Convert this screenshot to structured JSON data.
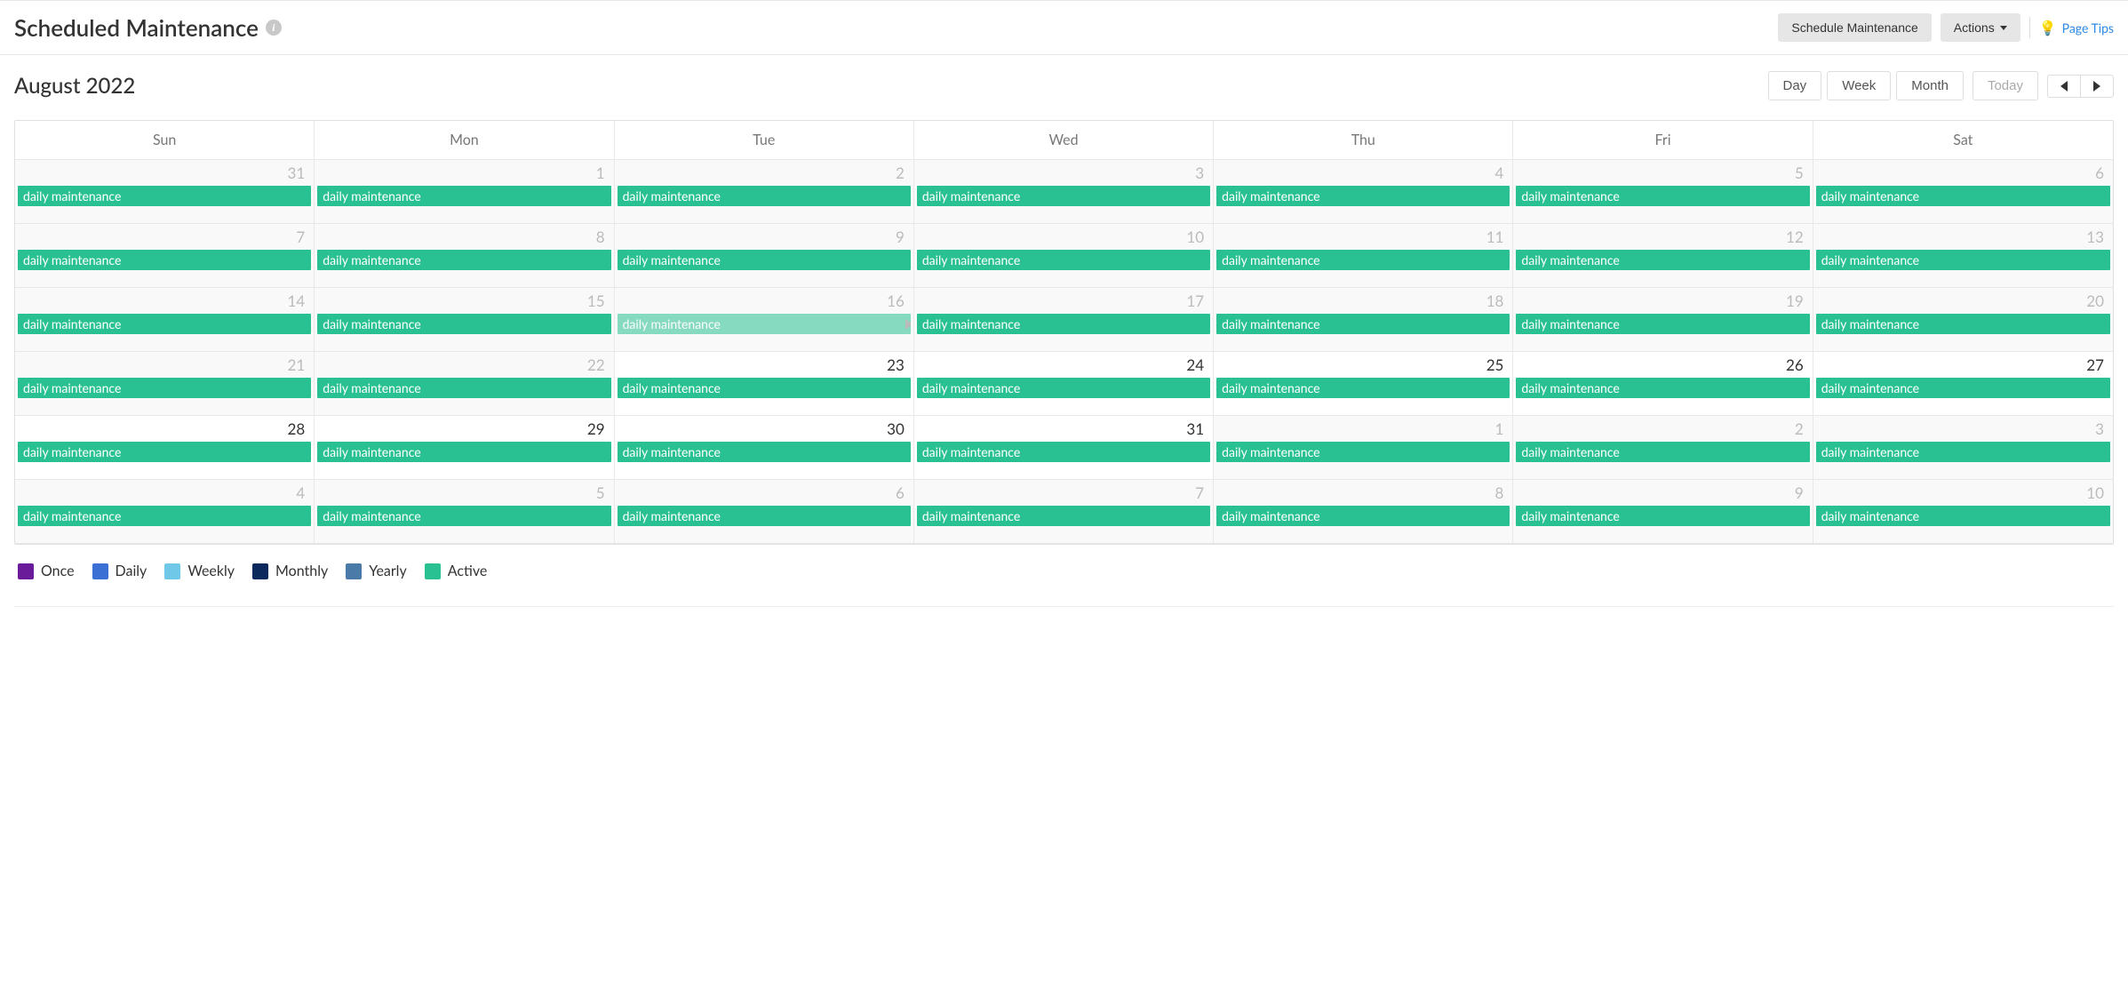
{
  "header": {
    "title": "Scheduled Maintenance",
    "schedule_btn": "Schedule Maintenance",
    "actions_btn": "Actions",
    "page_tips": "Page Tips"
  },
  "calendar": {
    "title": "August 2022",
    "views": {
      "day": "Day",
      "week": "Week",
      "month": "Month"
    },
    "today": "Today",
    "days_of_week": [
      "Sun",
      "Mon",
      "Tue",
      "Wed",
      "Thu",
      "Fri",
      "Sat"
    ],
    "event_label": "daily maintenance",
    "weeks": [
      [
        {
          "num": "31",
          "other": true
        },
        {
          "num": "1",
          "other": true
        },
        {
          "num": "2",
          "other": true
        },
        {
          "num": "3",
          "other": true
        },
        {
          "num": "4",
          "other": true
        },
        {
          "num": "5",
          "other": true
        },
        {
          "num": "6",
          "other": true
        }
      ],
      [
        {
          "num": "7",
          "other": true
        },
        {
          "num": "8",
          "other": true
        },
        {
          "num": "9",
          "other": true
        },
        {
          "num": "10",
          "other": true
        },
        {
          "num": "11",
          "other": true
        },
        {
          "num": "12",
          "other": true
        },
        {
          "num": "13",
          "other": true
        }
      ],
      [
        {
          "num": "14",
          "other": true
        },
        {
          "num": "15",
          "other": true
        },
        {
          "num": "16",
          "other": true,
          "dragging": true
        },
        {
          "num": "17",
          "other": true
        },
        {
          "num": "18",
          "other": true
        },
        {
          "num": "19",
          "other": true
        },
        {
          "num": "20",
          "other": true
        }
      ],
      [
        {
          "num": "21",
          "other": true
        },
        {
          "num": "22",
          "other": true
        },
        {
          "num": "23",
          "other": false
        },
        {
          "num": "24",
          "other": false
        },
        {
          "num": "25",
          "other": false
        },
        {
          "num": "26",
          "other": false
        },
        {
          "num": "27",
          "other": false
        }
      ],
      [
        {
          "num": "28",
          "other": false
        },
        {
          "num": "29",
          "other": false
        },
        {
          "num": "30",
          "other": false
        },
        {
          "num": "31",
          "other": false
        },
        {
          "num": "1",
          "other": true
        },
        {
          "num": "2",
          "other": true
        },
        {
          "num": "3",
          "other": true
        }
      ],
      [
        {
          "num": "4",
          "other": true
        },
        {
          "num": "5",
          "other": true
        },
        {
          "num": "6",
          "other": true
        },
        {
          "num": "7",
          "other": true
        },
        {
          "num": "8",
          "other": true
        },
        {
          "num": "9",
          "other": true
        },
        {
          "num": "10",
          "other": true
        }
      ]
    ]
  },
  "legend": [
    {
      "label": "Once",
      "color": "#6a1b9a"
    },
    {
      "label": "Daily",
      "color": "#3b6fd4"
    },
    {
      "label": "Weekly",
      "color": "#6fc8e8"
    },
    {
      "label": "Monthly",
      "color": "#0b2a5b"
    },
    {
      "label": "Yearly",
      "color": "#4a7aa8"
    },
    {
      "label": "Active",
      "color": "#29c191"
    }
  ]
}
